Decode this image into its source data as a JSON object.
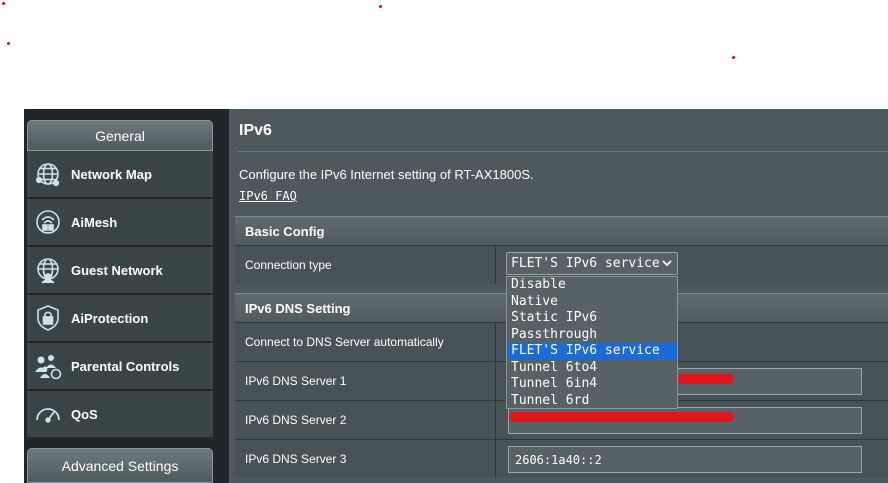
{
  "sidebar": {
    "header": "General",
    "items": [
      {
        "label": "Network Map",
        "icon": "globe-icon"
      },
      {
        "label": "AiMesh",
        "icon": "mesh-icon"
      },
      {
        "label": "Guest Network",
        "icon": "guest-globe-icon"
      },
      {
        "label": "AiProtection",
        "icon": "lock-icon"
      },
      {
        "label": "Parental Controls",
        "icon": "family-icon"
      },
      {
        "label": "QoS",
        "icon": "speedometer-icon"
      }
    ],
    "advanced": "Advanced Settings"
  },
  "main": {
    "title": "IPv6",
    "description": "Configure the IPv6 Internet setting of RT-AX1800S.",
    "faq_link": "IPv6 FAQ",
    "basic_config": {
      "heading": "Basic Config",
      "connection_type_label": "Connection type",
      "connection_type_value": "FLET'S IPv6 service",
      "options": [
        "Disable",
        "Native",
        "Static IPv6",
        "Passthrough",
        "FLET'S IPv6 service",
        "Tunnel 6to4",
        "Tunnel 6in4",
        "Tunnel 6rd"
      ],
      "selected_option": "FLET'S IPv6 service"
    },
    "dns": {
      "heading": "IPv6 DNS Setting",
      "auto_label": "Connect to DNS Server automatically",
      "server1_label": "IPv6 DNS Server 1",
      "server2_label": "IPv6 DNS Server 2",
      "server3_label": "IPv6 DNS Server 3",
      "server3_value": "2606:1a40::2"
    }
  },
  "colors": {
    "sidebar_bg": "#1f272a",
    "main_bg": "#4d595d",
    "selected_option": "#1a6bd6",
    "redaction": "#e0161c"
  }
}
